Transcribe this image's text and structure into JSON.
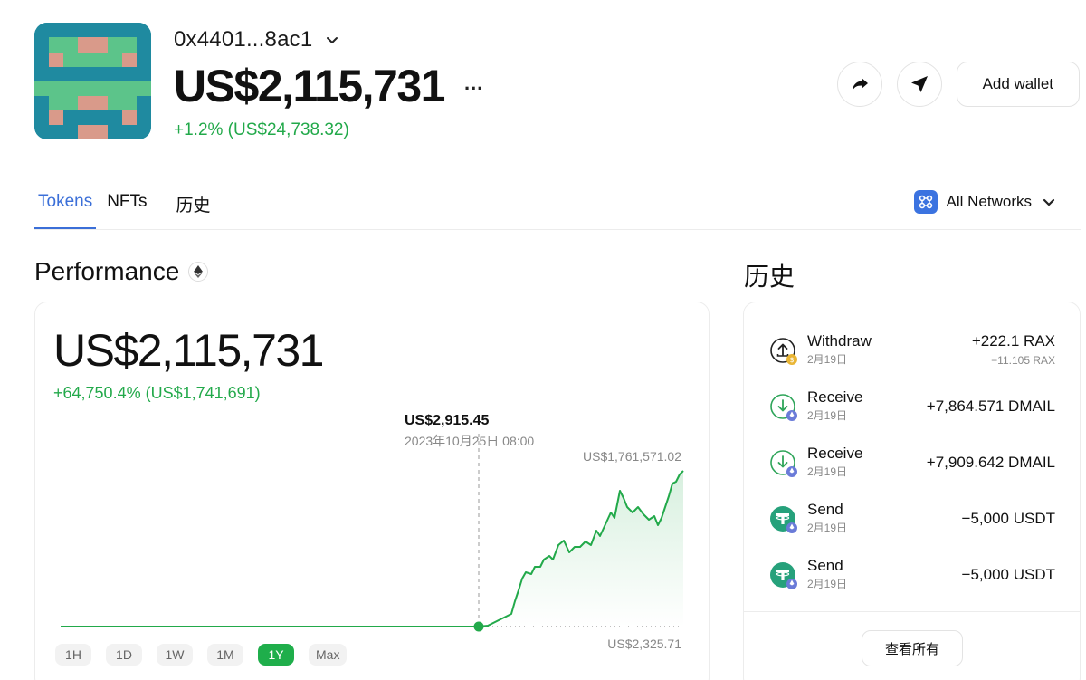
{
  "wallet": {
    "address": "0x4401...8ac1",
    "balance": "US$2,115,731",
    "more": "...",
    "change": "+1.2% (US$24,738.32)"
  },
  "actions": {
    "add_wallet_label": "Add wallet"
  },
  "tabs": [
    {
      "label": "Tokens",
      "active": true
    },
    {
      "label": "NFTs",
      "active": false
    },
    {
      "label": "历史",
      "active": false
    }
  ],
  "network": {
    "label": "All Networks"
  },
  "performance": {
    "title": "Performance",
    "balance": "US$2,115,731",
    "change": "+64,750.4% (US$1,741,691)",
    "tooltip_value": "US$2,915.45",
    "tooltip_date": "2023年10月25日 08:00",
    "max_label": "US$1,761,571.02",
    "min_label": "US$2,325.71",
    "ranges": [
      {
        "label": "1H",
        "active": false
      },
      {
        "label": "1D",
        "active": false
      },
      {
        "label": "1W",
        "active": false
      },
      {
        "label": "1M",
        "active": false
      },
      {
        "label": "1Y",
        "active": true
      },
      {
        "label": "Max",
        "active": false
      }
    ],
    "accent_color": "#22a94a"
  },
  "history": {
    "title": "历史",
    "items": [
      {
        "type": "Withdraw",
        "date": "2月19日",
        "amount": "+222.1 RAX",
        "sub": "−11.105 RAX",
        "icon": "upload-icon"
      },
      {
        "type": "Receive",
        "date": "2月19日",
        "amount": "+7,864.571 DMAIL",
        "sub": "",
        "icon": "download-icon"
      },
      {
        "type": "Receive",
        "date": "2月19日",
        "amount": "+7,909.642 DMAIL",
        "sub": "",
        "icon": "download-icon"
      },
      {
        "type": "Send",
        "date": "2月19日",
        "amount": "−5,000 USDT",
        "sub": "",
        "icon": "tether-icon"
      },
      {
        "type": "Send",
        "date": "2月19日",
        "amount": "−5,000 USDT",
        "sub": "",
        "icon": "tether-icon"
      }
    ],
    "view_all_label": "查看所有"
  }
}
